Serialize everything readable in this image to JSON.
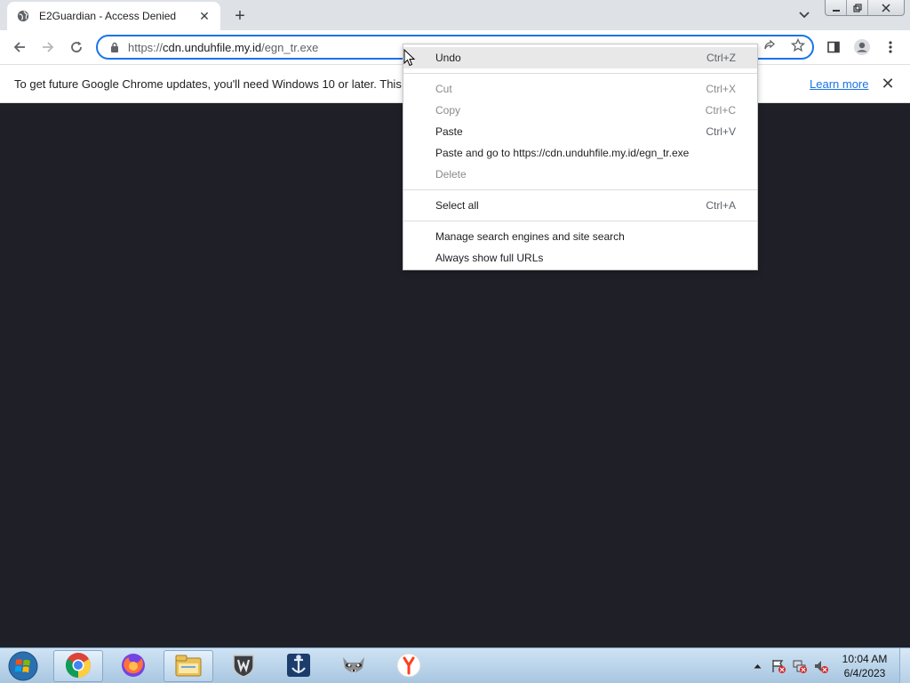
{
  "browser": {
    "tab_title": "E2Guardian - Access Denied",
    "new_tab_symbol": "+",
    "tab_close_symbol": "✕",
    "url_scheme": "https://",
    "url_host": "cdn.unduhfile.my.id",
    "url_path": "/egn_tr.exe"
  },
  "infobar": {
    "message": "To get future Google Chrome updates, you'll need Windows 10 or later. This",
    "learn_more": "Learn more",
    "close_symbol": "✕"
  },
  "context_menu": {
    "items": [
      {
        "label": "Undo",
        "shortcut": "Ctrl+Z",
        "enabled": true,
        "highlighted": true
      },
      {
        "label": "Cut",
        "shortcut": "Ctrl+X",
        "enabled": false
      },
      {
        "label": "Copy",
        "shortcut": "Ctrl+C",
        "enabled": false
      },
      {
        "label": "Paste",
        "shortcut": "Ctrl+V",
        "enabled": true
      },
      {
        "label": "Paste and go to https://cdn.unduhfile.my.id/egn_tr.exe",
        "shortcut": "",
        "enabled": true
      },
      {
        "label": "Delete",
        "shortcut": "",
        "enabled": false
      },
      {
        "label": "Select all",
        "shortcut": "Ctrl+A",
        "enabled": true
      },
      {
        "label": "Manage search engines and site search",
        "shortcut": "",
        "enabled": true
      },
      {
        "label": "Always show full URLs",
        "shortcut": "",
        "enabled": true
      }
    ]
  },
  "taskbar": {
    "apps": [
      "chrome-icon",
      "firefox-icon",
      "file-explorer-icon",
      "world-of-tanks-icon",
      "world-of-warships-icon",
      "raccoon-app-icon",
      "yandex-browser-icon"
    ],
    "clock_time": "10:04 AM",
    "clock_date": "6/4/2023"
  },
  "colors": {
    "accent": "#1a73e8",
    "page_background": "#1f2027",
    "tab_strip": "#dee1e6"
  }
}
